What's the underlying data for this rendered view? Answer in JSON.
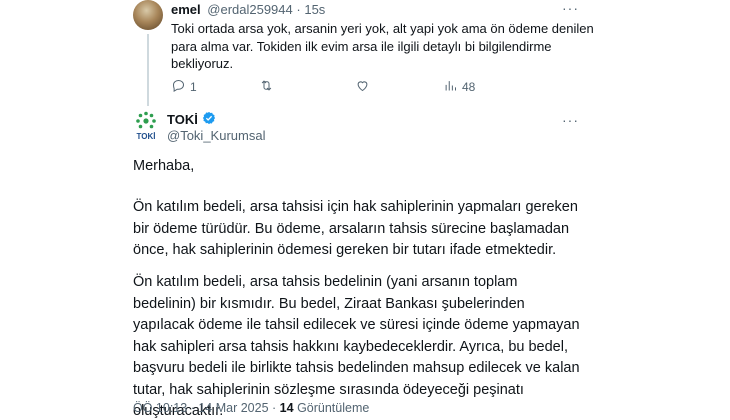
{
  "parent_tweet": {
    "name": "emel",
    "handle": "@erdal259944",
    "separator": "·",
    "time": "15s",
    "text": "Toki ortada arsa yok, arsanin yeri yok, alt yapi yok ama ön ödeme denilen para alma var. Tokiden ilk evim arsa ile ilgili detaylı bi bilgilendirme bekliyoruz.",
    "more": "···",
    "actions": {
      "reply_count": "1",
      "retweet_count": "",
      "like_count": "",
      "views_count": "48"
    }
  },
  "main_tweet": {
    "name": "TOKİ",
    "handle": "@Toki_Kurumsal",
    "more": "···",
    "logo_text": "TOKİ",
    "greeting": "Merhaba,",
    "paragraph1": "Ön katılım bedeli, arsa tahsisi için hak sahiplerinin yapmaları gereken bir ödeme türüdür. Bu ödeme, arsaların tahsis sürecine başlamadan önce, hak sahiplerinin ödemesi gereken bir tutarı ifade etmektedir.",
    "paragraph2": "Ön katılım bedeli, arsa tahsis bedelinin (yani arsanın toplam bedelinin) bir kısmıdır. Bu bedel, Ziraat Bankası şubelerinden yapılacak ödeme ile tahsil edilecek ve süresi içinde ödeme yapmayan hak sahipleri arsa tahsis hakkını kaybedeceklerdir. Ayrıca, bu bedel, başvuru bedeli ile birlikte tahsis bedelinden mahsup edilecek ve kalan tutar, hak sahiplerinin sözleşme sırasında ödeyeceği peşinatı oluşturacaktır.",
    "meta": {
      "time": "ÖÖ 10:13",
      "dot": "·",
      "date": "14 Mar 2025",
      "views_count": "14",
      "views_label": "Görüntüleme"
    }
  },
  "colors": {
    "text": "#0f1419",
    "secondary": "#536471",
    "verified": "#1d9bf0",
    "toki_green": "#2e9e4f",
    "toki_blue": "#1f4e8c"
  }
}
